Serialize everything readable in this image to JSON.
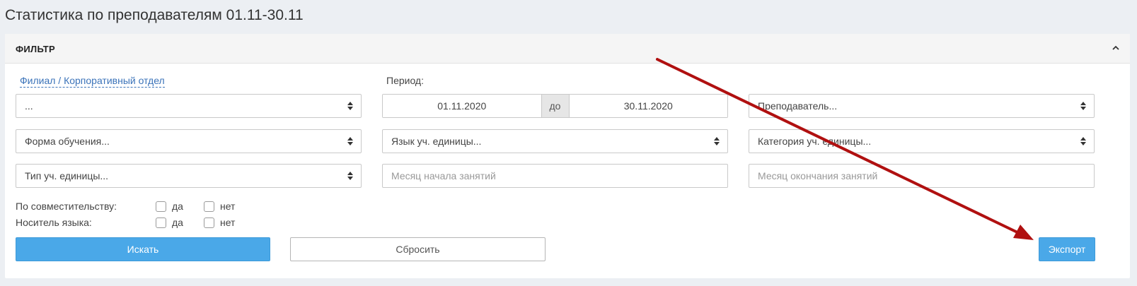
{
  "page": {
    "title": "Статистика по преподавателям 01.11-30.11"
  },
  "filter": {
    "title": "ФИЛЬТР",
    "branch_label": "Филиал / Корпоративный отдел",
    "branch_value": "...",
    "period_label": "Период:",
    "date_from": "01.11.2020",
    "date_sep": "до",
    "date_to": "30.11.2020",
    "teacher_select": "Преподаватель...",
    "study_form_select": "Форма обучения...",
    "language_select": "Язык уч. единицы...",
    "category_select": "Категория уч. единицы...",
    "unit_type_select": "Тип уч. единицы...",
    "start_month_placeholder": "Месяц начала занятий",
    "end_month_placeholder": "Месяц окончания занятий",
    "part_time_label": "По совместительству:",
    "native_label": "Носитель языка:",
    "yes": "да",
    "no": "нет",
    "search_button": "Искать",
    "reset_button": "Сбросить",
    "export_button": "Экспорт"
  },
  "colors": {
    "primary": "#4aa8e8",
    "link": "#3b73b9",
    "annotation_arrow": "#b01010"
  },
  "icons": {
    "collapse": "chevron-up-icon",
    "select_caret": "sort-caret-icon"
  }
}
